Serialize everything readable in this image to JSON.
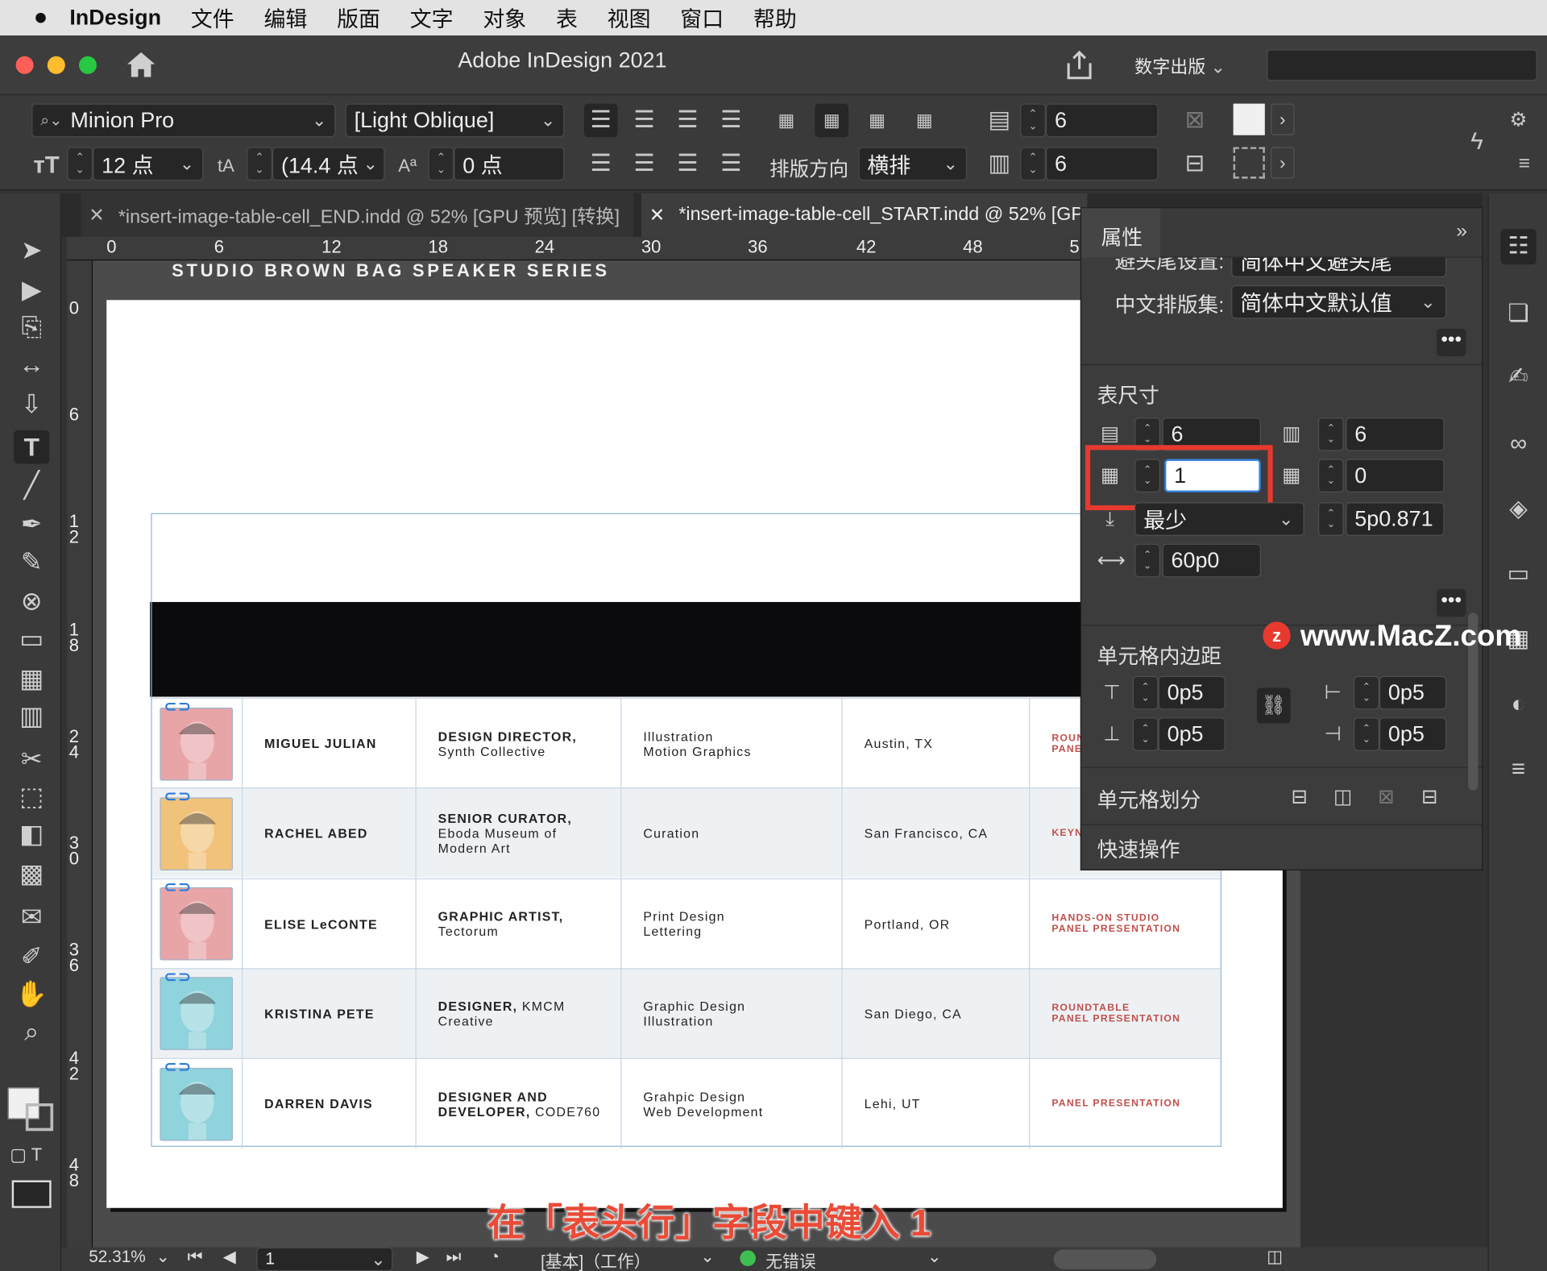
{
  "menubar": {
    "app": "InDesign",
    "items": [
      "文件",
      "编辑",
      "版面",
      "文字",
      "对象",
      "表",
      "视图",
      "窗口",
      "帮助"
    ]
  },
  "window": {
    "title": "Adobe InDesign 2021",
    "workspace": "数字出版"
  },
  "control": {
    "font_family": "Minion Pro",
    "font_style": "[Light Oblique]",
    "font_size": "12 点",
    "leading": "(14.4 点",
    "baseline": "0 点",
    "direction_label": "排版方向",
    "direction_value": "横排",
    "rows": "6",
    "cols": "6"
  },
  "tabs": [
    {
      "label": "*insert-image-table-cell_END.indd @ 52% [GPU 预览] [转换]"
    },
    {
      "label": "*insert-image-table-cell_START.indd @ 52% [GPU"
    }
  ],
  "ruler": {
    "h": [
      "0",
      "6",
      "12",
      "18",
      "24",
      "30",
      "36",
      "42",
      "48",
      "5"
    ],
    "v": [
      "0",
      "6",
      "1\n2",
      "1\n8",
      "2\n4",
      "3\n0",
      "3\n6",
      "4\n2",
      "4\n8"
    ]
  },
  "document": {
    "header": "STUDIO BROWN BAG SPEAKER SERIES",
    "rows": [
      {
        "name": "MIGUEL JULIAN",
        "title_bold": "DESIGN DIRECTOR,",
        "title_rest": "Synth Collective",
        "skills": [
          "Illustration",
          "Motion Graphics"
        ],
        "location": "Austin, TX",
        "presentation": [
          "ROUN",
          "PANE"
        ],
        "color": "#e8a5a8"
      },
      {
        "name": "RACHEL ABED",
        "title_bold": "SENIOR CURATOR,",
        "title_rest": "Eboda Museum of\nModern Art",
        "skills": [
          "Curation"
        ],
        "location": "San Francisco, CA",
        "presentation": [
          "KEYN"
        ],
        "color": "#f1c27a"
      },
      {
        "name": "ELISE LeCONTE",
        "title_bold": "GRAPHIC ARTIST,",
        "title_rest": "Tectorum",
        "skills": [
          "Print Design",
          "Lettering"
        ],
        "location": "Portland, OR",
        "presentation": [
          "HANDS-ON STUDIO",
          "PANEL PRESENTATION"
        ],
        "color": "#e8a5a8"
      },
      {
        "name": "KRISTINA PETE",
        "title_bold": "DESIGNER,",
        "title_extra": " KMCM",
        "title_rest": "Creative",
        "skills": [
          "Graphic Design",
          "Illustration"
        ],
        "location": "San Diego, CA",
        "presentation": [
          "ROUNDTABLE",
          "PANEL PRESENTATION"
        ],
        "color": "#8fd3dc"
      },
      {
        "name": "DARREN DAVIS",
        "title_bold": "DESIGNER AND\nDEVELOPER,",
        "title_extra": " CODE760",
        "title_rest": "",
        "skills": [
          "Grahpic Design",
          "Web Development"
        ],
        "location": "Lehi, UT",
        "presentation": [
          "PANEL PRESENTATION"
        ],
        "color": "#8fd3dc"
      }
    ]
  },
  "panel": {
    "title": "属性",
    "row1_label": "避头尾设置:",
    "row1_value": "简体中文避头尾",
    "row2_label": "中文排版集:",
    "row2_value": "简体中文默认值",
    "table_size": "表尺寸",
    "body_rows": "6",
    "columns": "6",
    "header_rows": "1",
    "footer_rows": "0",
    "row_height_mode": "最少",
    "row_height": "5p0.871",
    "col_width": "60p0",
    "inset_title": "单元格内边距",
    "inset_top": "0p5",
    "inset_bottom": "0p5",
    "inset_left": "0p5",
    "inset_right": "0p5",
    "split_title": "单元格划分",
    "quick_title": "快速操作"
  },
  "status": {
    "zoom": "52.31%",
    "page": "1",
    "style": "[基本]（工作）",
    "errors": "无错误"
  },
  "caption": "在「表头行」字段中键入 1",
  "watermark": "www.MacZ.com",
  "colors": {
    "highlight": "#e8392e",
    "accent": "#2f7bd9"
  }
}
